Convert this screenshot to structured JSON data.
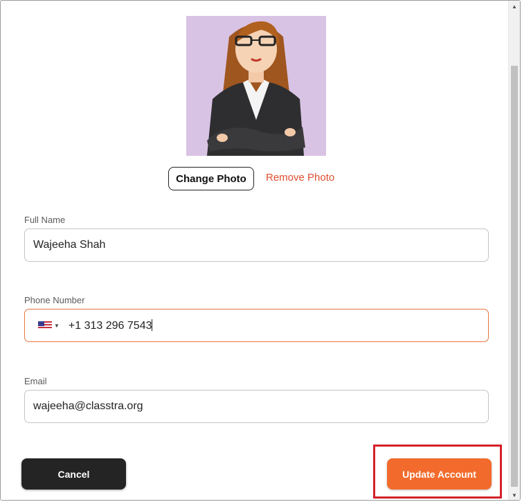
{
  "profile": {
    "avatar_icon": "profile-avatar-illustration",
    "change_photo_label": "Change Photo",
    "remove_photo_label": "Remove Photo"
  },
  "form": {
    "full_name": {
      "label": "Full Name",
      "value": "Wajeeha Shah"
    },
    "phone": {
      "label": "Phone Number",
      "country_icon": "us-flag-icon",
      "value": "+1 313 296 7543"
    },
    "email": {
      "label": "Email",
      "value": "wajeeha@classtra.org"
    }
  },
  "actions": {
    "cancel_label": "Cancel",
    "update_label": "Update Account"
  },
  "colors": {
    "accent": "#f26b2c",
    "remove_link": "#e04e2e",
    "highlight": "#d4202a",
    "avatar_bg": "#d9c3e4",
    "cancel_bg": "#242424"
  }
}
